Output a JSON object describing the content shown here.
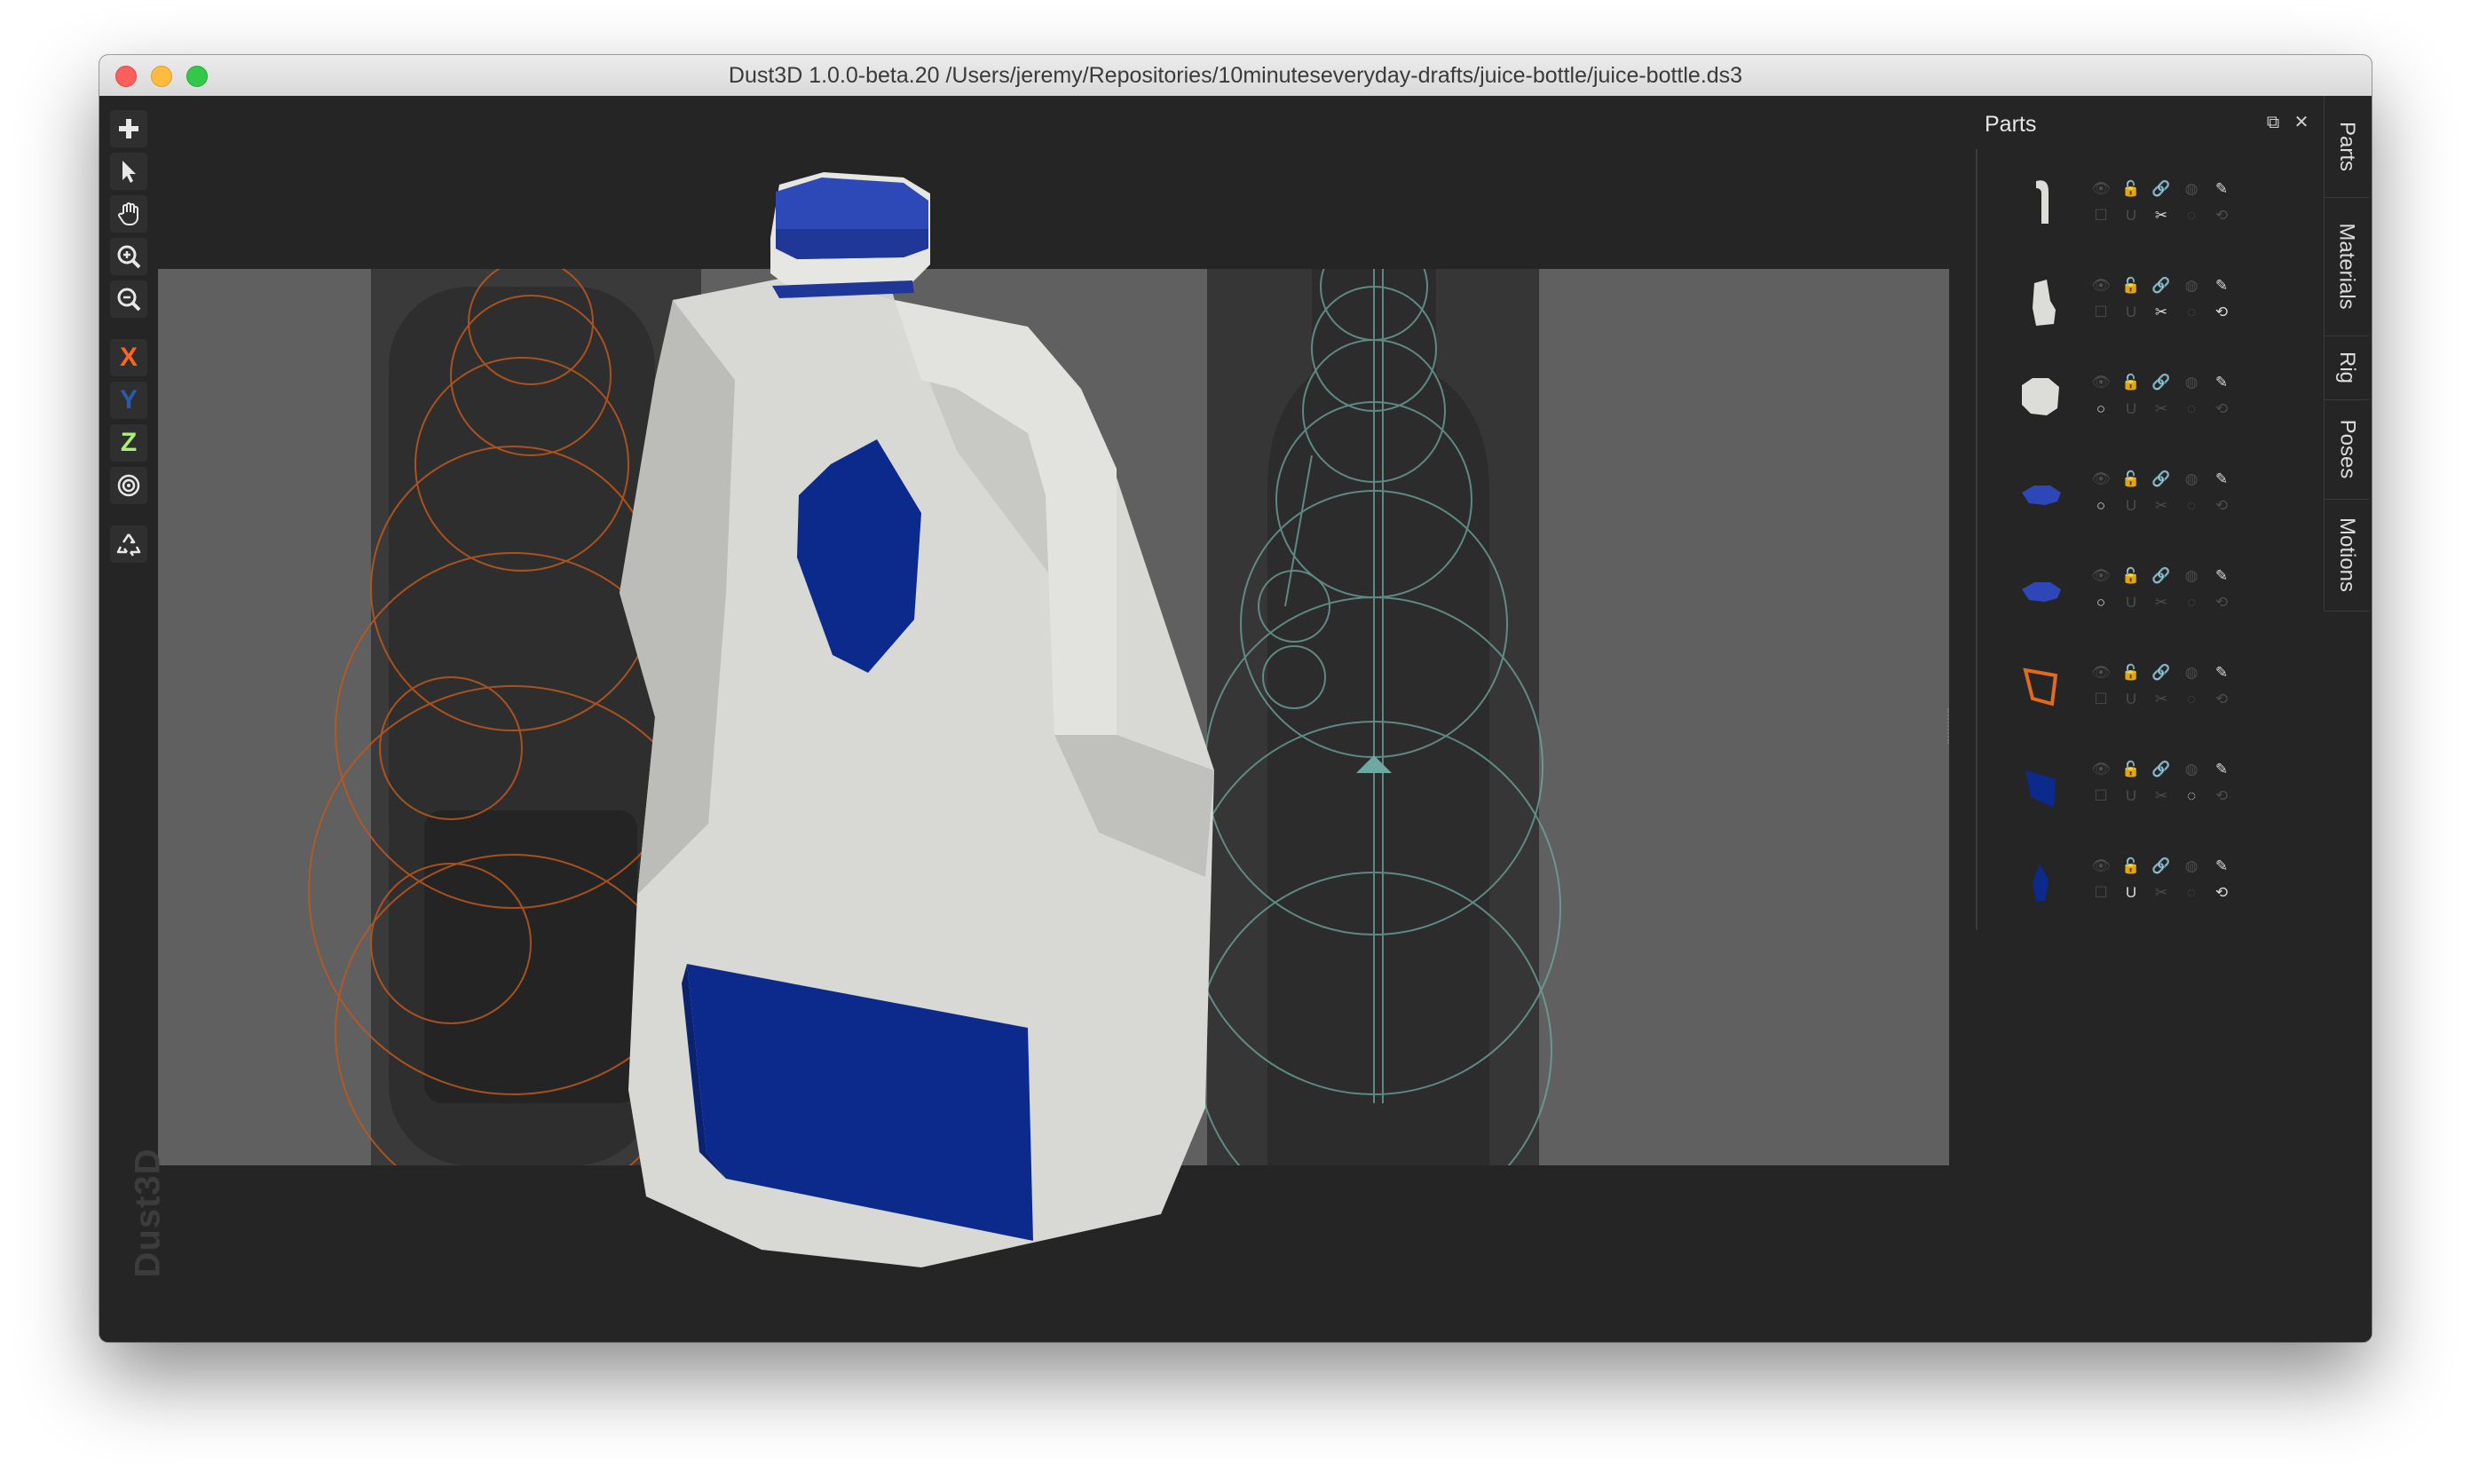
{
  "window": {
    "title": "Dust3D 1.0.0-beta.20 /Users/jeremy/Repositories/10minuteseveryday-drafts/juice-bottle/juice-bottle.ds3"
  },
  "toolbar": {
    "tools": [
      {
        "icon": "plus-icon"
      },
      {
        "icon": "cursor-icon"
      },
      {
        "icon": "hand-icon"
      },
      {
        "icon": "zoom-in-icon"
      },
      {
        "icon": "zoom-out-icon"
      }
    ],
    "axis_x": "X",
    "axis_y": "Y",
    "axis_z": "Z",
    "radial_icon": "radial-mirror-icon",
    "regenerate_icon": "recycle-icon",
    "watermark": "Dust3D"
  },
  "parts_panel": {
    "title": "Parts",
    "parts": [
      {
        "thumb": "handle",
        "color": "#dcdcd8"
      },
      {
        "thumb": "body-small",
        "color": "#dcdcd8"
      },
      {
        "thumb": "cap-white",
        "color": "#dcdcd8"
      },
      {
        "thumb": "cap-blue",
        "color": "#2e46b8"
      },
      {
        "thumb": "cap-blue",
        "color": "#2e46b8"
      },
      {
        "thumb": "outline",
        "color": "#e06a1e"
      },
      {
        "thumb": "label",
        "color": "#0c2a8c"
      },
      {
        "thumb": "diamond",
        "color": "#0c2a8c"
      }
    ]
  },
  "tabs": [
    "Parts",
    "Materials",
    "Rig",
    "Poses",
    "Motions"
  ],
  "colors": {
    "accent_blue": "#0c2a8c",
    "bottle_white": "#dcdcd8",
    "x_axis": "#fc6621",
    "y_axis": "#2a5aac",
    "z_axis": "#aaf072"
  }
}
